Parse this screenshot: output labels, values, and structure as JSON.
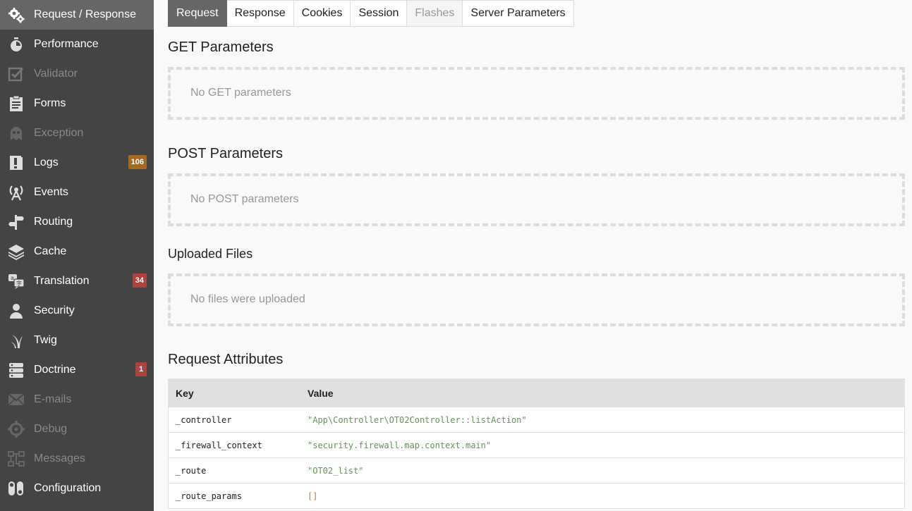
{
  "sidebar": {
    "items": [
      {
        "label": "Request / Response",
        "icon": "gears-icon",
        "state": "active"
      },
      {
        "label": "Performance",
        "icon": "stopwatch-icon",
        "state": "normal"
      },
      {
        "label": "Validator",
        "icon": "checkbox-icon",
        "state": "disabled"
      },
      {
        "label": "Forms",
        "icon": "clipboard-icon",
        "state": "normal"
      },
      {
        "label": "Exception",
        "icon": "ghost-icon",
        "state": "disabled"
      },
      {
        "label": "Logs",
        "icon": "exclamation-icon",
        "state": "normal",
        "count": "106",
        "count_color": "#a46a1f"
      },
      {
        "label": "Events",
        "icon": "broadcast-tower-icon",
        "state": "normal"
      },
      {
        "label": "Routing",
        "icon": "signpost-icon",
        "state": "normal"
      },
      {
        "label": "Cache",
        "icon": "layers-icon",
        "state": "normal"
      },
      {
        "label": "Translation",
        "icon": "translate-icon",
        "state": "normal",
        "count": "34",
        "count_color": "#b0413e"
      },
      {
        "label": "Security",
        "icon": "user-icon",
        "state": "normal"
      },
      {
        "label": "Twig",
        "icon": "twig-icon",
        "state": "normal"
      },
      {
        "label": "Doctrine",
        "icon": "database-icon",
        "state": "normal",
        "count": "1",
        "count_color": "#b0413e"
      },
      {
        "label": "E-mails",
        "icon": "envelope-icon",
        "state": "disabled"
      },
      {
        "label": "Debug",
        "icon": "crosshair-icon",
        "state": "disabled"
      },
      {
        "label": "Messages",
        "icon": "messages-icon",
        "state": "disabled"
      },
      {
        "label": "Configuration",
        "icon": "toggles-icon",
        "state": "normal"
      }
    ]
  },
  "tabs": [
    {
      "label": "Request",
      "state": "active"
    },
    {
      "label": "Response",
      "state": "normal"
    },
    {
      "label": "Cookies",
      "state": "normal"
    },
    {
      "label": "Session",
      "state": "normal"
    },
    {
      "label": "Flashes",
      "state": "disabled"
    },
    {
      "label": "Server Parameters",
      "state": "normal"
    }
  ],
  "sections": {
    "get": {
      "title": "GET Parameters",
      "empty": "No GET parameters"
    },
    "post": {
      "title": "POST Parameters",
      "empty": "No POST parameters"
    },
    "files": {
      "title": "Uploaded Files",
      "empty": "No files were uploaded"
    },
    "attributes": {
      "title": "Request Attributes",
      "columns": {
        "key": "Key",
        "value": "Value"
      },
      "rows": [
        {
          "key": "_controller",
          "value": "\"App\\Controller\\OT02Controller::listAction\"",
          "kind": "string"
        },
        {
          "key": "_firewall_context",
          "value": "\"security.firewall.map.context.main\"",
          "kind": "string"
        },
        {
          "key": "_route",
          "value": "\"OT02_list\"",
          "kind": "string"
        },
        {
          "key": "_route_params",
          "value": "[]",
          "kind": "array"
        }
      ]
    }
  },
  "colors": {
    "sidebar_bg": "#444444",
    "active_bg": "#666666",
    "string_value": "#629755",
    "array_value": "#cc7832"
  }
}
